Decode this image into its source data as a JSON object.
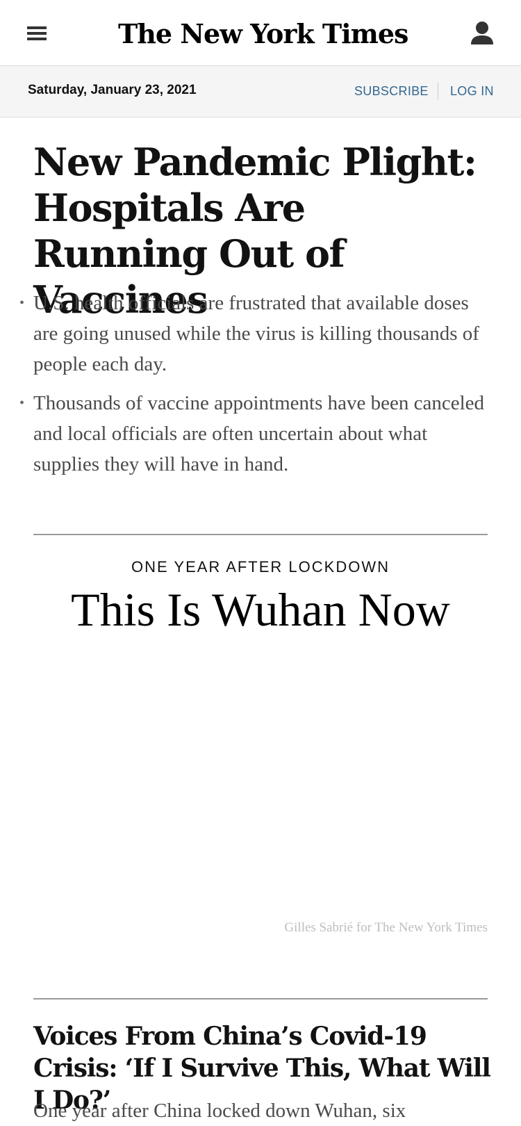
{
  "masthead": {
    "logo_text": "The New York Times",
    "menu_icon": "hamburger-menu-icon",
    "account_icon": "user-account-icon"
  },
  "date_bar": {
    "date": "Saturday, January 23, 2021",
    "subscribe_label": "SUBSCRIBE",
    "login_label": "LOG IN",
    "link_color": "#326891"
  },
  "lead_story": {
    "headline": "New Pandemic Plight: Hospitals Are Running Out of Vaccines",
    "summary": [
      "U.S. health officials are frustrated that available doses are going unused while the virus is killing thousands of people each day.",
      "Thousands of vaccine appointments have been canceled and local officials are often uncertain about what supplies they will have in hand."
    ]
  },
  "feature": {
    "kicker": "ONE YEAR AFTER LOCKDOWN",
    "title": "This Is Wuhan Now",
    "photo_credit": "Gilles Sabrié for The New York Times"
  },
  "second_story": {
    "headline": "Voices From China’s Covid-19 Crisis: ‘If I Survive This, What Will I Do?’",
    "summary_partial": "One year after China locked down Wuhan, six"
  }
}
